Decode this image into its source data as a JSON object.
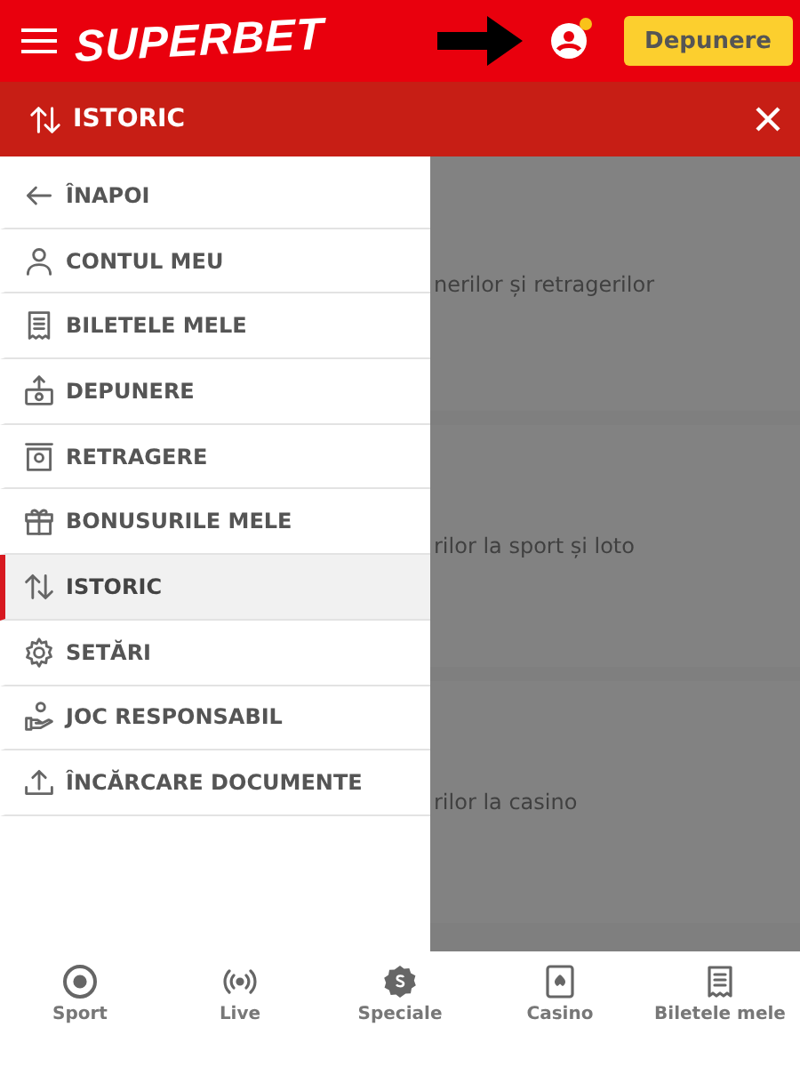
{
  "header": {
    "logo": "SUPERBET",
    "deposit_button": "Depunere",
    "notification_dot": true
  },
  "subheader": {
    "title": "ISTORIC"
  },
  "menu": [
    {
      "label": "ÎNAPOI",
      "selected": false
    },
    {
      "label": "CONTUL MEU",
      "selected": false
    },
    {
      "label": "BILETELE MELE",
      "selected": false
    },
    {
      "label": "DEPUNERE",
      "selected": false
    },
    {
      "label": "RETRAGERE",
      "selected": false
    },
    {
      "label": "BONUSURILE MELE",
      "selected": false
    },
    {
      "label": "ISTORIC",
      "selected": true
    },
    {
      "label": "SETĂRI",
      "selected": false
    },
    {
      "label": "JOC RESPONSABIL",
      "selected": false
    },
    {
      "label": "ÎNCĂRCARE DOCUMENTE",
      "selected": false
    }
  ],
  "background_cards": [
    {
      "text": "nerilor și retragerilor"
    },
    {
      "text": "rilor la sport și loto"
    },
    {
      "text": "rilor la casino"
    }
  ],
  "bottom_nav": [
    {
      "label": "Sport"
    },
    {
      "label": "Live"
    },
    {
      "label": "Speciale"
    },
    {
      "label": "Casino"
    },
    {
      "label": "Biletele mele"
    }
  ]
}
